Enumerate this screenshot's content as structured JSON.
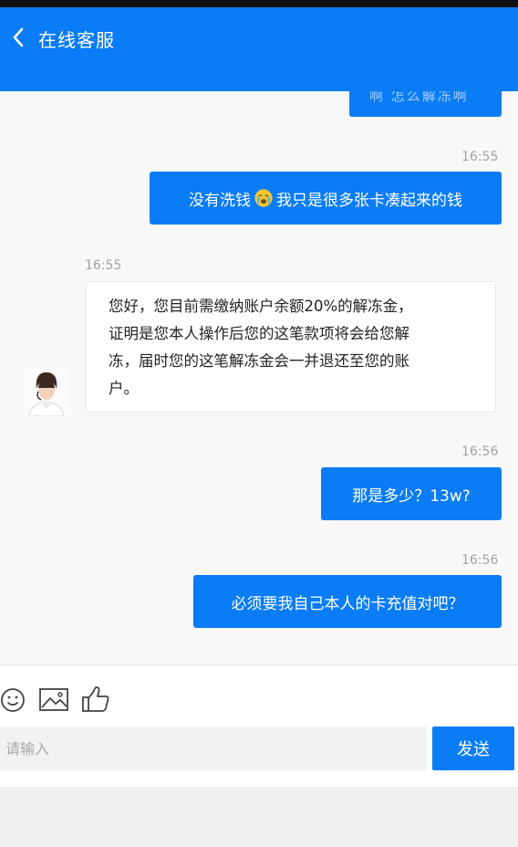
{
  "header": {
    "title": "在线客服",
    "back_icon": "chevron-left-icon",
    "bg_color": "#0a7cf5"
  },
  "messages": [
    {
      "side": "out",
      "text": "啊 怎么解冻啊",
      "partial": true
    },
    {
      "side": "out",
      "time": "16:55",
      "text_a": "没有洗钱",
      "emoji": "crying-face-emoji",
      "text_b": "我只是很多张卡凑起来的钱"
    },
    {
      "side": "in",
      "time": "16:55",
      "avatar": "agent-avatar",
      "lines": [
        "您好，您目前需缴纳账户余额20%的解冻金，",
        "证明是您本人操作后您的这笔款项将会给您解",
        "冻，届时您的这笔解冻金会一并退还至您的账",
        "户。"
      ]
    },
    {
      "side": "out",
      "time": "16:56",
      "text": "那是多少？13w?"
    },
    {
      "side": "out",
      "time": "16:56",
      "text": "必须要我自己本人的卡充值对吧？"
    }
  ],
  "toolbar": {
    "icons": [
      "smiley-icon",
      "image-icon",
      "thumbs-up-icon"
    ]
  },
  "composer": {
    "placeholder": "请输入",
    "send_label": "发送"
  }
}
